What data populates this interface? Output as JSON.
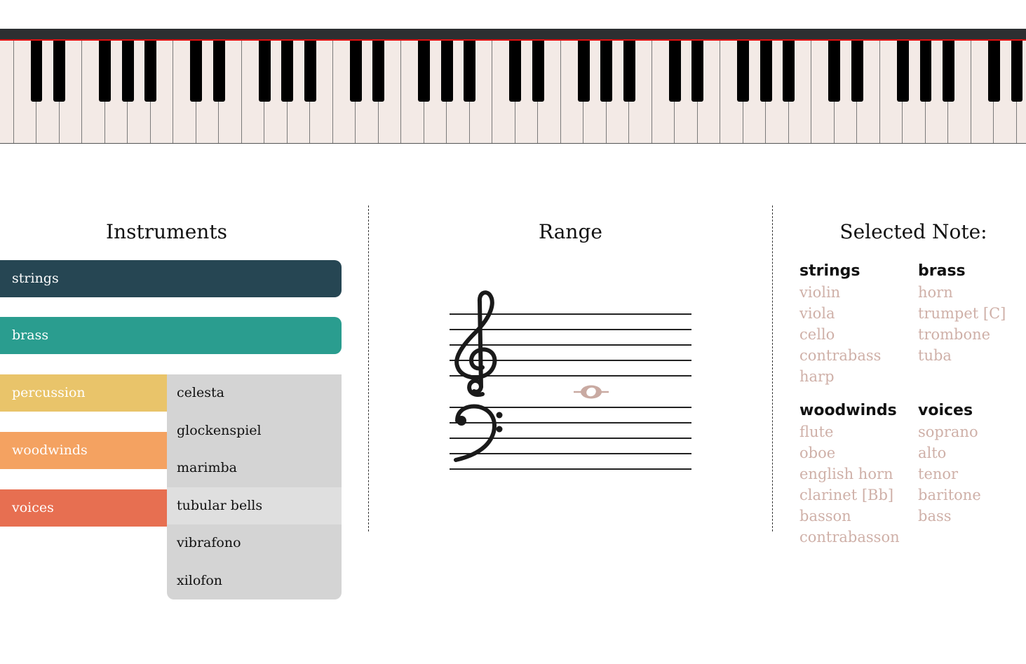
{
  "instruments_title": "Instruments",
  "range_title": "Range",
  "selected_title": "Selected Note:",
  "families": [
    {
      "label": "strings",
      "color": "#264653"
    },
    {
      "label": "brass",
      "color": "#2a9d8f"
    },
    {
      "label": "percussion",
      "color": "#e9c46a"
    },
    {
      "label": "woodwinds",
      "color": "#f4a261"
    },
    {
      "label": "voices",
      "color": "#e76f51"
    }
  ],
  "percussion_menu": [
    "celesta",
    "glockenspiel",
    "marimba",
    "tubular bells",
    "vibrafono",
    "xilofon"
  ],
  "selected": {
    "strings": {
      "heading": "strings",
      "items": [
        "violin",
        "viola",
        "cello",
        "contrabass",
        "harp"
      ]
    },
    "brass": {
      "heading": "brass",
      "items": [
        "horn",
        "trumpet [C]",
        "trombone",
        "tuba"
      ]
    },
    "woodwinds": {
      "heading": "woodwinds",
      "items": [
        "flute",
        "oboe",
        "english horn",
        "clarinet [Bb]",
        "basson",
        "contrabasson"
      ]
    },
    "voices": {
      "heading": "voices",
      "items": [
        "soprano",
        "alto",
        "tenor",
        "baritone",
        "bass"
      ]
    }
  },
  "colors": {
    "inactive_instrument": "#cfb0a8",
    "note": "#c9aaa2",
    "piano_white": "#f3eae6"
  },
  "icons": {
    "treble": "treble-clef-icon",
    "bass": "bass-clef-icon",
    "note": "whole-note-icon"
  }
}
